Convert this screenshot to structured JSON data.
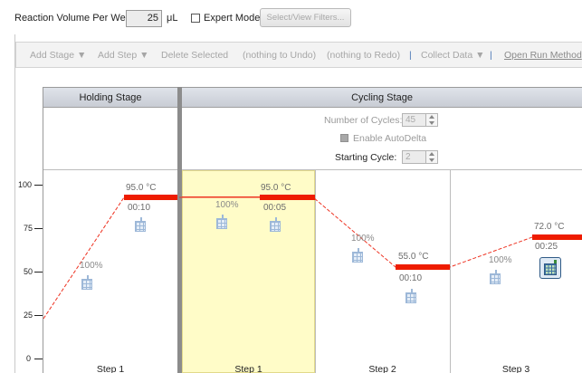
{
  "top": {
    "reaction_volume_label": "Reaction Volume Per Well",
    "reaction_volume_value": "25",
    "reaction_volume_unit": "μL",
    "expert_mode_label": "Expert Mode",
    "select_filters_label": "Select/View Filters..."
  },
  "toolbar": {
    "add_stage": "Add Stage ▼",
    "add_step": "Add Step ▼",
    "delete_selected": "Delete Selected",
    "undo": "(nothing to Undo)",
    "redo": "(nothing to Redo)",
    "separator": "|",
    "collect_data": "Collect Data ▼",
    "open_run_method": "Open Run Method"
  },
  "stages": {
    "holding_title": "Holding Stage",
    "cycling_title": "Cycling Stage",
    "number_of_cycles_label": "Number of Cycles:",
    "number_of_cycles_value": "45",
    "enable_autodelta_label": "Enable AutoDelta",
    "starting_cycle_label": "Starting Cycle:",
    "starting_cycle_value": "2"
  },
  "y_axis": {
    "ticks": [
      "100",
      "75",
      "50",
      "25",
      "0"
    ]
  },
  "steps": [
    {
      "label": "Step 1",
      "temp": "95.0 °C",
      "time": "00:10",
      "ramp": "100%"
    },
    {
      "label": "Step 1",
      "temp": "95.0 °C",
      "time": "00:05",
      "ramp": "100%"
    },
    {
      "label": "Step 2",
      "temp": "55.0 °C",
      "time": "00:10",
      "ramp": "100%"
    },
    {
      "label": "Step 3",
      "temp": "72.0 °C",
      "time": "00:25",
      "ramp": "100%"
    }
  ],
  "colors": {
    "plateau": "#ee1c00",
    "ramp_line": "#ee3322",
    "selected_step_bg": "#fffcc8"
  }
}
